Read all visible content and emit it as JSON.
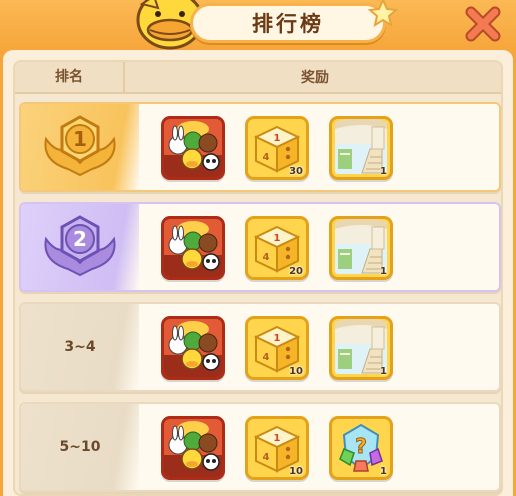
{
  "title": "排行榜",
  "columns": {
    "rank": "排名",
    "reward": "奖励"
  },
  "rows": [
    {
      "rank": "1",
      "style": "gold",
      "items": [
        {
          "type": "character-bundle",
          "qty": ""
        },
        {
          "type": "dice",
          "qty": "30"
        },
        {
          "type": "scenery-card",
          "qty": "1"
        }
      ]
    },
    {
      "rank": "2",
      "style": "purple",
      "items": [
        {
          "type": "character-bundle",
          "qty": ""
        },
        {
          "type": "dice",
          "qty": "20"
        },
        {
          "type": "scenery-card",
          "qty": "1"
        }
      ]
    },
    {
      "rank": "3~4",
      "style": "plain",
      "items": [
        {
          "type": "character-bundle",
          "qty": ""
        },
        {
          "type": "dice",
          "qty": "10"
        },
        {
          "type": "scenery-card",
          "qty": "1"
        }
      ]
    },
    {
      "rank": "5~10",
      "style": "plain",
      "items": [
        {
          "type": "character-bundle",
          "qty": ""
        },
        {
          "type": "dice",
          "qty": "10"
        },
        {
          "type": "mystery-crystal",
          "qty": "1"
        }
      ]
    }
  ],
  "dice_faces": {
    "top": "1",
    "left": "4",
    "right": ""
  },
  "mystery_symbol": "?",
  "colors": {
    "header": "#f6a53a",
    "gold": "#f8c35c",
    "purple": "#cfbdf4",
    "close": "#f0764f"
  }
}
